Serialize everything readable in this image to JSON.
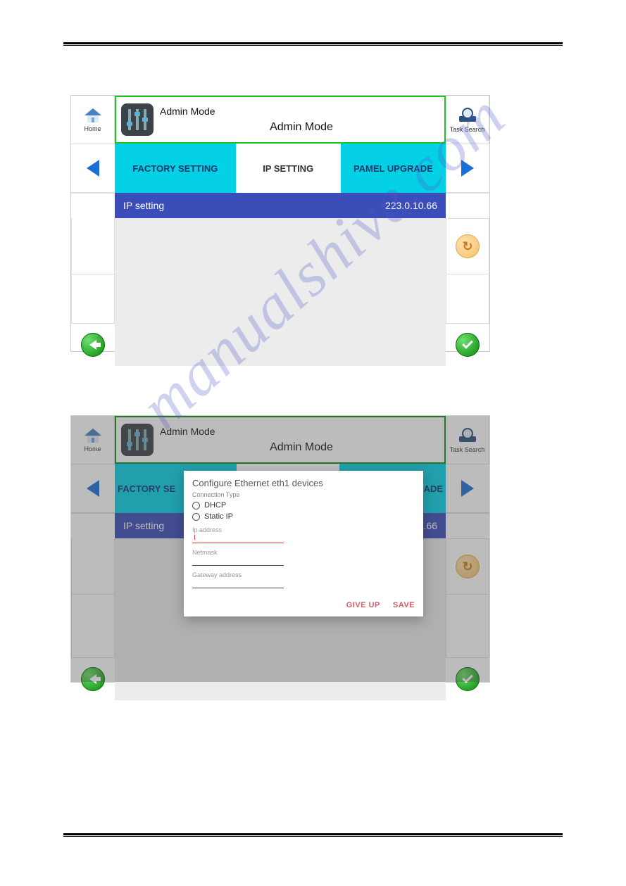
{
  "watermark": "manualshive.com",
  "shot1": {
    "home_label": "Home",
    "task_label": "Task Search",
    "admin_line1": "Admin Mode",
    "admin_line2": "Admin Mode",
    "tabs": {
      "factory": "FACTORY SETTING",
      "ip": "IP SETTING",
      "upgrade": "PAMEL UPGRADE"
    },
    "ip_label": "IP setting",
    "ip_value": "223.0.10.66"
  },
  "shot2": {
    "home_label": "Home",
    "task_label": "Task Search",
    "admin_line1": "Admin Mode",
    "admin_line2": "Admin Mode",
    "tabs": {
      "factory_trunc": "FACTORY SE",
      "upgrade_trunc": "ADE"
    },
    "ip_label": "IP setting",
    "ip_value_trunc": "0.66",
    "dialog": {
      "title": "Configure Ethernet eth1 devices",
      "conn_type_label": "Connection Type",
      "opt_dhcp": "DHCP",
      "opt_static": "Static IP",
      "ip_label": "Ip address",
      "ip_value": "I",
      "netmask_label": "Netmask",
      "gateway_label": "Gateway address",
      "btn_giveup": "GIVE UP",
      "btn_save": "SAVE"
    }
  }
}
